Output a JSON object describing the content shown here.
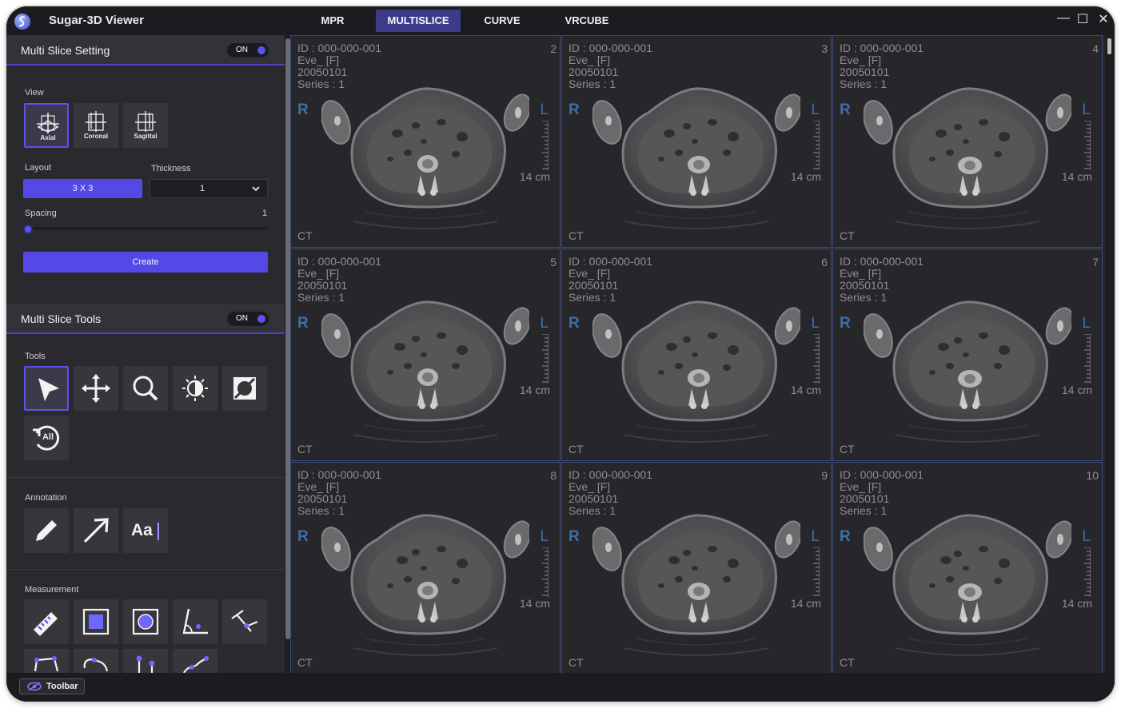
{
  "app": {
    "title": "Sugar-3D Viewer"
  },
  "tabs": [
    {
      "label": "MPR"
    },
    {
      "label": "MULTISLICE"
    },
    {
      "label": "CURVE"
    },
    {
      "label": "VRCUBE"
    }
  ],
  "multi_slice_setting": {
    "title": "Multi Slice Setting",
    "toggle": "ON",
    "view_label": "View",
    "views": [
      "Axial",
      "Coronal",
      "Sagittal"
    ],
    "layout_label": "Layout",
    "layout_value": "3 X 3",
    "thickness_label": "Thickness",
    "thickness_value": "1",
    "spacing_label": "Spacing",
    "spacing_value": "1",
    "create_label": "Create"
  },
  "multi_slice_tools": {
    "title": "Multi Slice Tools",
    "toggle": "ON",
    "tools_label": "Tools",
    "annotation_label": "Annotation",
    "measurement_label": "Measurement",
    "reset_all": "All",
    "text_tool": "Aa"
  },
  "bottom": {
    "toolbar_label": "Toolbar"
  },
  "viewer": {
    "id_line": "ID : 000-000-001",
    "name_line": "Eve_ [F]",
    "date_line": "20050101",
    "series_line": "Series : 1",
    "left_marker": "R",
    "right_marker": "L",
    "scale_label": "14 cm",
    "modality": "CT",
    "cells": [
      {
        "num": "2"
      },
      {
        "num": "3"
      },
      {
        "num": "4"
      },
      {
        "num": "5"
      },
      {
        "num": "6"
      },
      {
        "num": "7"
      },
      {
        "num": "8"
      },
      {
        "num": "9"
      },
      {
        "num": "10"
      }
    ]
  },
  "colors": {
    "accent": "#5449e6",
    "panel": "#2a2a2e",
    "viewer_bg": "#27272b",
    "marker": "#3e6fa8"
  }
}
